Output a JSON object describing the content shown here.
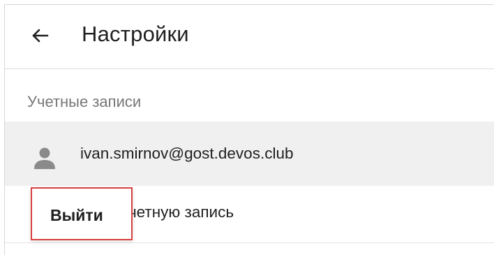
{
  "header": {
    "back_icon": "arrow-left-icon",
    "title": "Настройки"
  },
  "accounts_section": {
    "heading": "Учетные записи",
    "account": {
      "avatar_icon": "person-icon",
      "email": "ivan.smirnov@gost.devos.club"
    },
    "add_account_label": "Добавить учетную запись"
  },
  "popup_menu": {
    "logout_label": "Выйти"
  },
  "colors": {
    "text_primary": "#1f1f1f",
    "text_secondary": "#777777",
    "row_highlight": "#f0f0f0",
    "popup_border": "#d84040",
    "icon_gray": "#8a8a8a"
  }
}
